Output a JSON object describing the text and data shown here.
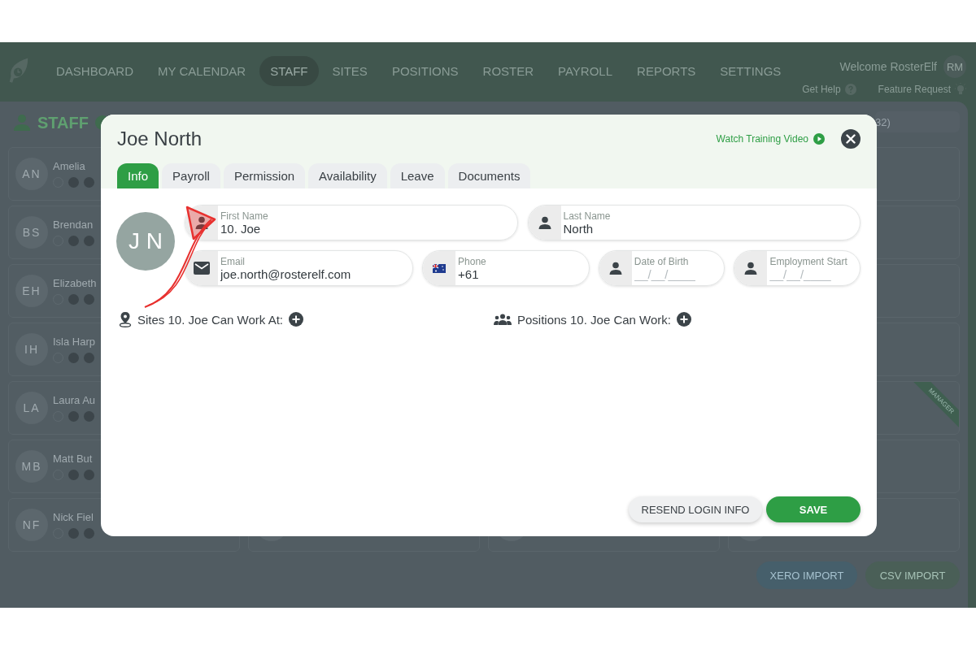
{
  "nav": {
    "items": [
      {
        "label": "DASHBOARD",
        "selected": false
      },
      {
        "label": "MY CALENDAR",
        "selected": false
      },
      {
        "label": "STAFF",
        "selected": true
      },
      {
        "label": "SITES",
        "selected": false
      },
      {
        "label": "POSITIONS",
        "selected": false
      },
      {
        "label": "ROSTER",
        "selected": false
      },
      {
        "label": "PAYROLL",
        "selected": false
      },
      {
        "label": "REPORTS",
        "selected": false
      },
      {
        "label": "SETTINGS",
        "selected": false
      }
    ],
    "welcome": "Welcome RosterElf",
    "avatar": "RM",
    "help": "Get Help",
    "feature": "Feature Request"
  },
  "staff_page": {
    "title": "STAFF",
    "count": "32)",
    "cards": [
      {
        "initials": "AN",
        "name": "Amelia"
      },
      {
        "initials": "BS",
        "name": "Brendan"
      },
      {
        "initials": "EH",
        "name": "Elizabeth"
      },
      {
        "initials": "IH",
        "name": "Isla Harp"
      },
      {
        "initials": "LA",
        "name": "Laura Au"
      },
      {
        "initials": "MB",
        "name": "Matt But"
      },
      {
        "initials": "NF",
        "name": "Nick Fiel"
      }
    ],
    "ribbon": "MANAGER",
    "buttons": [
      "XERO IMPORT",
      "CSV IMPORT"
    ]
  },
  "modal": {
    "title": "Joe North",
    "training_link": "Watch Training Video",
    "tabs": [
      {
        "label": "Info",
        "selected": true
      },
      {
        "label": "Payroll",
        "selected": false
      },
      {
        "label": "Permission",
        "selected": false
      },
      {
        "label": "Availability",
        "selected": false
      },
      {
        "label": "Leave",
        "selected": false
      },
      {
        "label": "Documents",
        "selected": false
      }
    ],
    "avatar": "J N",
    "name_fields": [
      {
        "kind": "name",
        "label": "First Name",
        "value": "10. Joe"
      },
      {
        "kind": "name",
        "label": "Last Name",
        "value": "North"
      }
    ],
    "detail_fields": [
      {
        "kind": "email",
        "label": "Email",
        "value": "joe.north@rosterelf.com"
      },
      {
        "kind": "phone",
        "label": "Phone",
        "value": "+61"
      },
      {
        "kind": "date",
        "label": "Date of Birth",
        "placeholder": "__/__/____"
      },
      {
        "kind": "date",
        "label": "Employment Start",
        "placeholder": "__/__/____"
      }
    ],
    "sections": [
      {
        "kind": "sites",
        "label": "Sites 10. Joe Can Work At:"
      },
      {
        "kind": "positions",
        "label": "Positions 10. Joe Can Work:"
      }
    ],
    "buttons": [
      {
        "kind": "secondary",
        "label": "RESEND LOGIN INFO"
      },
      {
        "kind": "primary",
        "label": "SAVE"
      }
    ]
  }
}
